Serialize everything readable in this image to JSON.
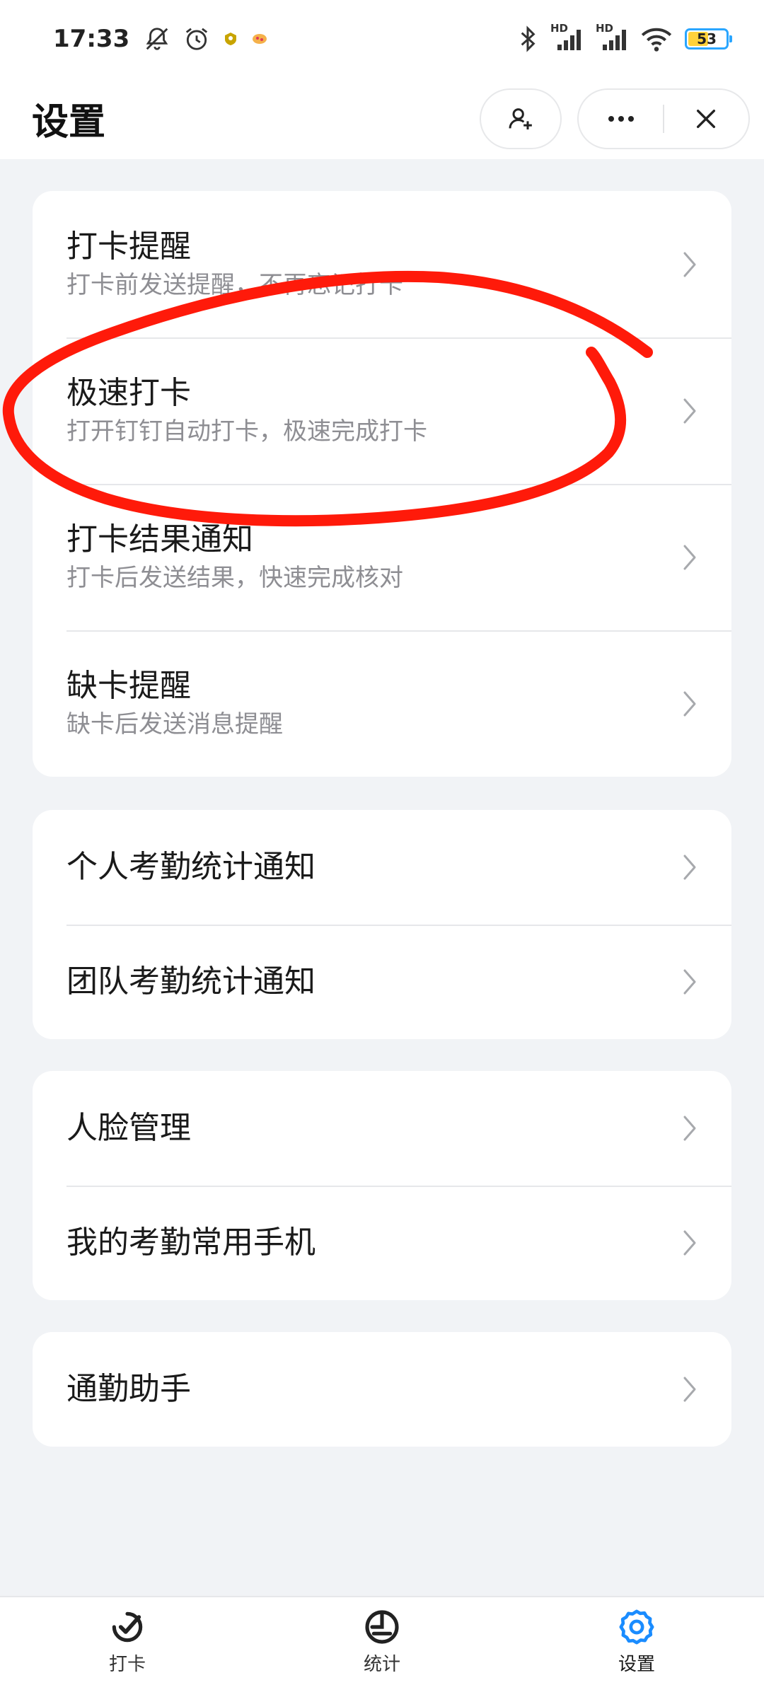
{
  "status_bar": {
    "time": "17:33",
    "network_1": "HD",
    "network_2": "HD",
    "battery": "53",
    "icons": [
      "mute-bell-icon",
      "alarm-icon",
      "app-notification-icon",
      "app-notification-icon",
      "bluetooth-icon",
      "signal-icon",
      "signal-icon",
      "wifi-icon",
      "battery-icon"
    ]
  },
  "header": {
    "title": "设置",
    "actions": [
      "add-contact-icon",
      "more-icon",
      "close-icon"
    ]
  },
  "groups": [
    {
      "items": [
        {
          "title": "打卡提醒",
          "subtitle": "打卡前发送提醒，不再忘记打卡"
        },
        {
          "title": "极速打卡",
          "subtitle": "打开钉钉自动打卡，极速完成打卡"
        },
        {
          "title": "打卡结果通知",
          "subtitle": "打卡后发送结果，快速完成核对"
        },
        {
          "title": "缺卡提醒",
          "subtitle": "缺卡后发送消息提醒"
        }
      ]
    },
    {
      "items": [
        {
          "title": "个人考勤统计通知"
        },
        {
          "title": "团队考勤统计通知"
        }
      ]
    },
    {
      "items": [
        {
          "title": "人脸管理"
        },
        {
          "title": "我的考勤常用手机"
        }
      ]
    },
    {
      "items": [
        {
          "title": "通勤助手"
        }
      ]
    }
  ],
  "tabbar": {
    "tabs": [
      {
        "label": "打卡",
        "icon": "check-in-icon",
        "active": false
      },
      {
        "label": "统计",
        "icon": "stats-pie-icon",
        "active": false
      },
      {
        "label": "设置",
        "icon": "gear-icon",
        "active": true
      }
    ]
  },
  "colors": {
    "accent": "#1a8cff",
    "annotation": "#ff1a0a",
    "background": "#f1f3f6"
  }
}
